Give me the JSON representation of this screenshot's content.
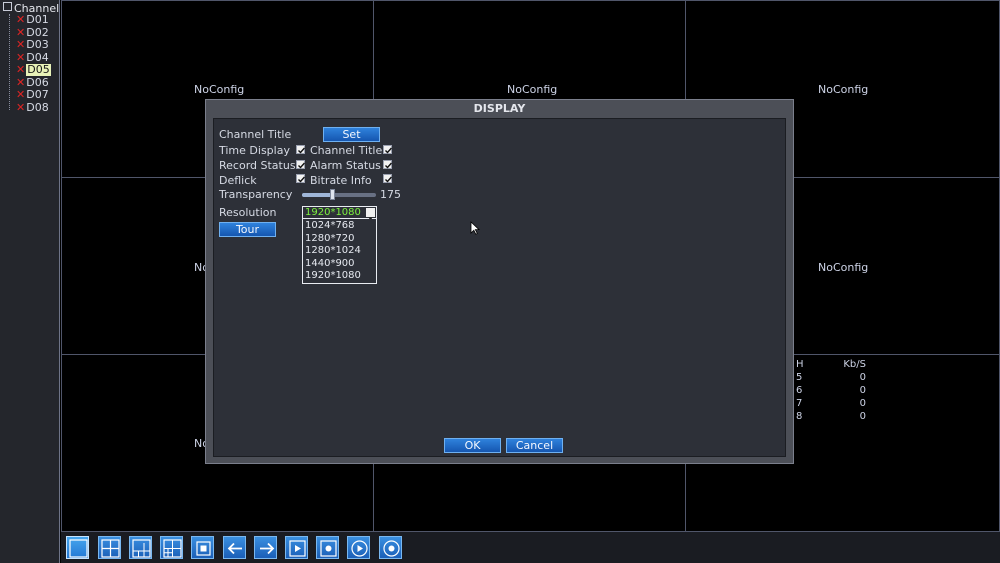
{
  "sidebar": {
    "root_label": "Channel",
    "channels": [
      {
        "label": "D01",
        "status": "error"
      },
      {
        "label": "D02",
        "status": "error"
      },
      {
        "label": "D03",
        "status": "error"
      },
      {
        "label": "D04",
        "status": "error"
      },
      {
        "label": "D05",
        "status": "error",
        "selected": true
      },
      {
        "label": "D06",
        "status": "error"
      },
      {
        "label": "D07",
        "status": "error"
      },
      {
        "label": "D08",
        "status": "error"
      }
    ]
  },
  "grid": {
    "cells": [
      {
        "label": "NoConfig"
      },
      {
        "label": "NoConfig"
      },
      {
        "label": "NoConfig"
      },
      {
        "label": "No"
      },
      {
        "label": ""
      },
      {
        "label": "NoConfig"
      },
      {
        "label": "No"
      },
      {
        "label": ""
      },
      {
        "label": ""
      }
    ]
  },
  "stats": {
    "header": {
      "ch": "H",
      "kbs": "Kb/S"
    },
    "rows": [
      {
        "ch": "5",
        "kbs": "0"
      },
      {
        "ch": "6",
        "kbs": "0"
      },
      {
        "ch": "7",
        "kbs": "0"
      },
      {
        "ch": "8",
        "kbs": "0"
      }
    ]
  },
  "dialog": {
    "title": "DISPLAY",
    "channel_title_label": "Channel Title",
    "set_button": "Set",
    "time_display_label": "Time Display",
    "time_display_checked": true,
    "channel_title_toggle_label": "Channel Title",
    "channel_title_checked": true,
    "record_status_label": "Record Status",
    "record_status_checked": true,
    "alarm_status_label": "Alarm Status",
    "alarm_status_checked": true,
    "deflick_label": "Deflick",
    "deflick_checked": true,
    "bitrate_info_label": "Bitrate Info",
    "bitrate_info_checked": true,
    "transparency_label": "Transparency",
    "transparency_value": "175",
    "transparency_fraction": 0.4,
    "resolution_label": "Resolution",
    "resolution_selected": "1920*1080",
    "resolution_options": [
      "1024*768",
      "1280*720",
      "1280*1024",
      "1440*900",
      "1920*1080"
    ],
    "tour_button": "Tour",
    "ok_button": "OK",
    "cancel_button": "Cancel"
  },
  "toolbar": {
    "buttons": [
      {
        "icon": "single-view-icon",
        "active": true
      },
      {
        "icon": "quad-view-icon"
      },
      {
        "icon": "multi-view-icon"
      },
      {
        "icon": "nine-view-icon"
      },
      {
        "icon": "stop-icon"
      },
      {
        "icon": "arrow-left-icon"
      },
      {
        "icon": "arrow-right-icon"
      },
      {
        "icon": "play-icon"
      },
      {
        "icon": "record-icon"
      },
      {
        "icon": "playback-icon"
      },
      {
        "icon": "target-icon"
      }
    ]
  },
  "colors": {
    "accent_blue": "#1f6fd0",
    "error_red": "#e02424",
    "selected_value_green": "#7cf23e"
  }
}
